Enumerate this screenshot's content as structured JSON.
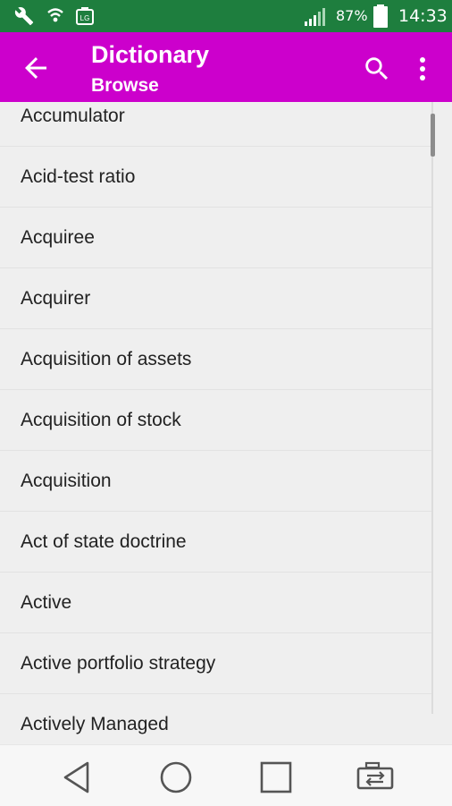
{
  "status_bar": {
    "battery": "87%",
    "time": "14:33",
    "icons": [
      "wrench-icon",
      "wifi-icon",
      "lg-icon",
      "signal-icon",
      "battery-icon"
    ]
  },
  "app_bar": {
    "title": "Dictionary",
    "subtitle": "Browse",
    "color": "#cc00cc"
  },
  "list": {
    "items": [
      "Accumulator",
      "Acid-test ratio",
      "Acquiree",
      "Acquirer",
      "Acquisition of assets",
      "Acquisition of stock",
      "Acquisition",
      "Act of state doctrine",
      "Active",
      "Active portfolio strategy",
      "Actively Managed"
    ]
  },
  "nav_bar": {
    "buttons": [
      "back-triangle-icon",
      "home-circle-icon",
      "recents-square-icon",
      "dual-window-icon"
    ]
  }
}
